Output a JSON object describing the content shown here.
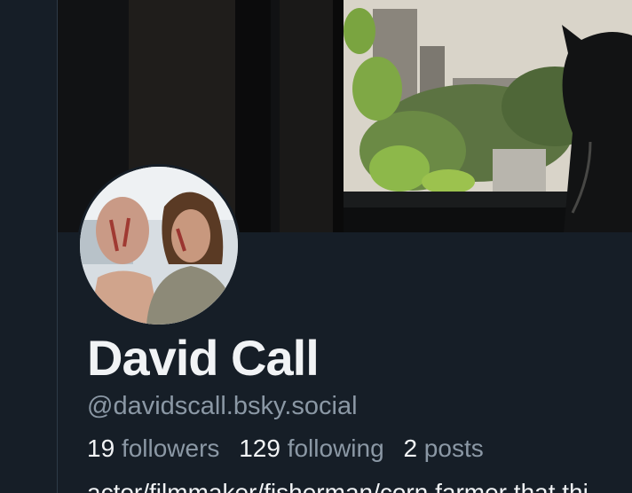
{
  "profile": {
    "display_name": "David Call",
    "handle": "@davidscall.bsky.social",
    "followers_count": "19",
    "followers_label": "followers",
    "following_count": "129",
    "following_label": "following",
    "posts_count": "2",
    "posts_label": "posts",
    "bio_preview": "actor/filmmaker/fisherman/corn farmer that thi"
  },
  "colors": {
    "background": "#161e27",
    "primary_text": "#f1f3f5",
    "secondary_text": "#8b98a5"
  }
}
